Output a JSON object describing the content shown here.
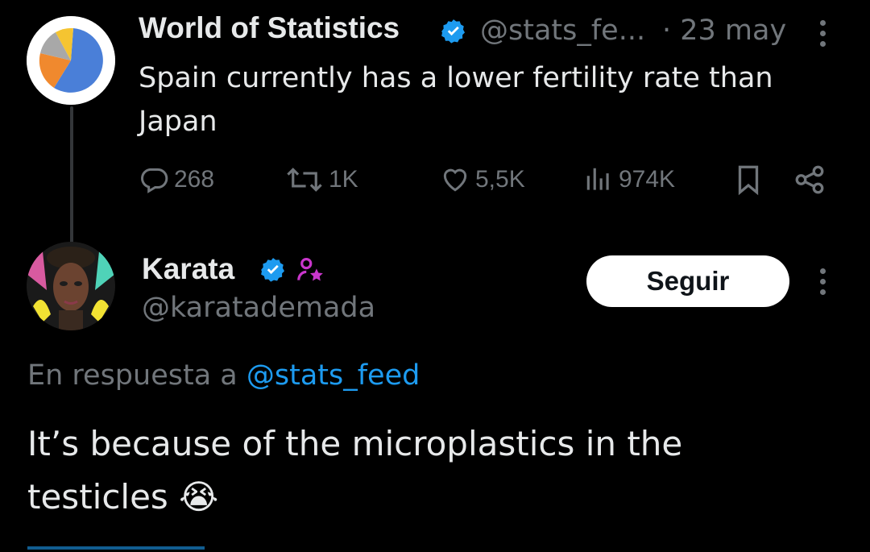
{
  "original_tweet": {
    "author_name": "World of Statistics",
    "handle": "@stats_fe...",
    "date": "· 23 may",
    "text": "Spain currently has a lower fertility rate than Japan",
    "stats": {
      "replies": "268",
      "reposts": "1K",
      "likes": "5,5K",
      "views": "974K"
    }
  },
  "reply_tweet": {
    "author_name": "Karata",
    "handle": "@karatademada",
    "follow_label": "Seguir",
    "reply_prefix": "En respuesta a",
    "reply_to": "@stats_feed",
    "text": "It’s because of the microplastics in the testicles",
    "emoji": "😭"
  },
  "colors": {
    "background": "#000000",
    "text_primary": "#e7e9ea",
    "text_muted": "#71767b",
    "link": "#1d9bf0",
    "verified": "#1d9bf0",
    "subscriber_badge": "#c936cc"
  }
}
